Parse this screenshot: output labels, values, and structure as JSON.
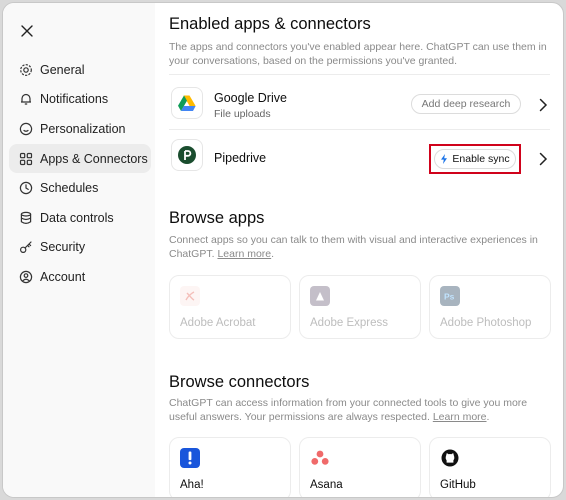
{
  "sidebar": {
    "items": [
      {
        "label": "General",
        "icon": "gear-icon"
      },
      {
        "label": "Notifications",
        "icon": "bell-icon"
      },
      {
        "label": "Personalization",
        "icon": "smiley-icon"
      },
      {
        "label": "Apps & Connectors",
        "icon": "grid-icon",
        "active": true
      },
      {
        "label": "Schedules",
        "icon": "clock-icon"
      },
      {
        "label": "Data controls",
        "icon": "database-icon"
      },
      {
        "label": "Security",
        "icon": "key-icon"
      },
      {
        "label": "Account",
        "icon": "user-icon"
      }
    ]
  },
  "enabled": {
    "title": "Enabled apps & connectors",
    "description": "The apps and connectors you've enabled appear here. ChatGPT can use them in your conversations, based on the permissions you've granted.",
    "items": [
      {
        "name": "Google Drive",
        "subtitle": "File uploads",
        "action": "Add deep research",
        "icon": "google-drive-icon"
      },
      {
        "name": "Pipedrive",
        "subtitle": "",
        "action": "Enable sync",
        "icon": "pipedrive-icon"
      }
    ]
  },
  "apps": {
    "title": "Browse apps",
    "description": "Connect apps so you can talk to them with visual and interactive experiences in ChatGPT.",
    "learn_more": "Learn more",
    "items": [
      {
        "name": "Adobe Acrobat",
        "icon": "adobe-acrobat-icon"
      },
      {
        "name": "Adobe Express",
        "icon": "adobe-express-icon"
      },
      {
        "name": "Adobe Photoshop",
        "icon": "adobe-photoshop-icon"
      }
    ]
  },
  "connectors": {
    "title": "Browse connectors",
    "description": "ChatGPT can access information from your connected tools to give you more useful answers. Your permissions are always respected.",
    "learn_more": "Learn more",
    "items": [
      {
        "name": "Aha!",
        "icon": "aha-icon"
      },
      {
        "name": "Asana",
        "icon": "asana-icon"
      },
      {
        "name": "GitHub",
        "icon": "github-icon"
      }
    ]
  },
  "colors": {
    "highlight": "#d0021b",
    "sync_icon": "#1a73e8"
  }
}
